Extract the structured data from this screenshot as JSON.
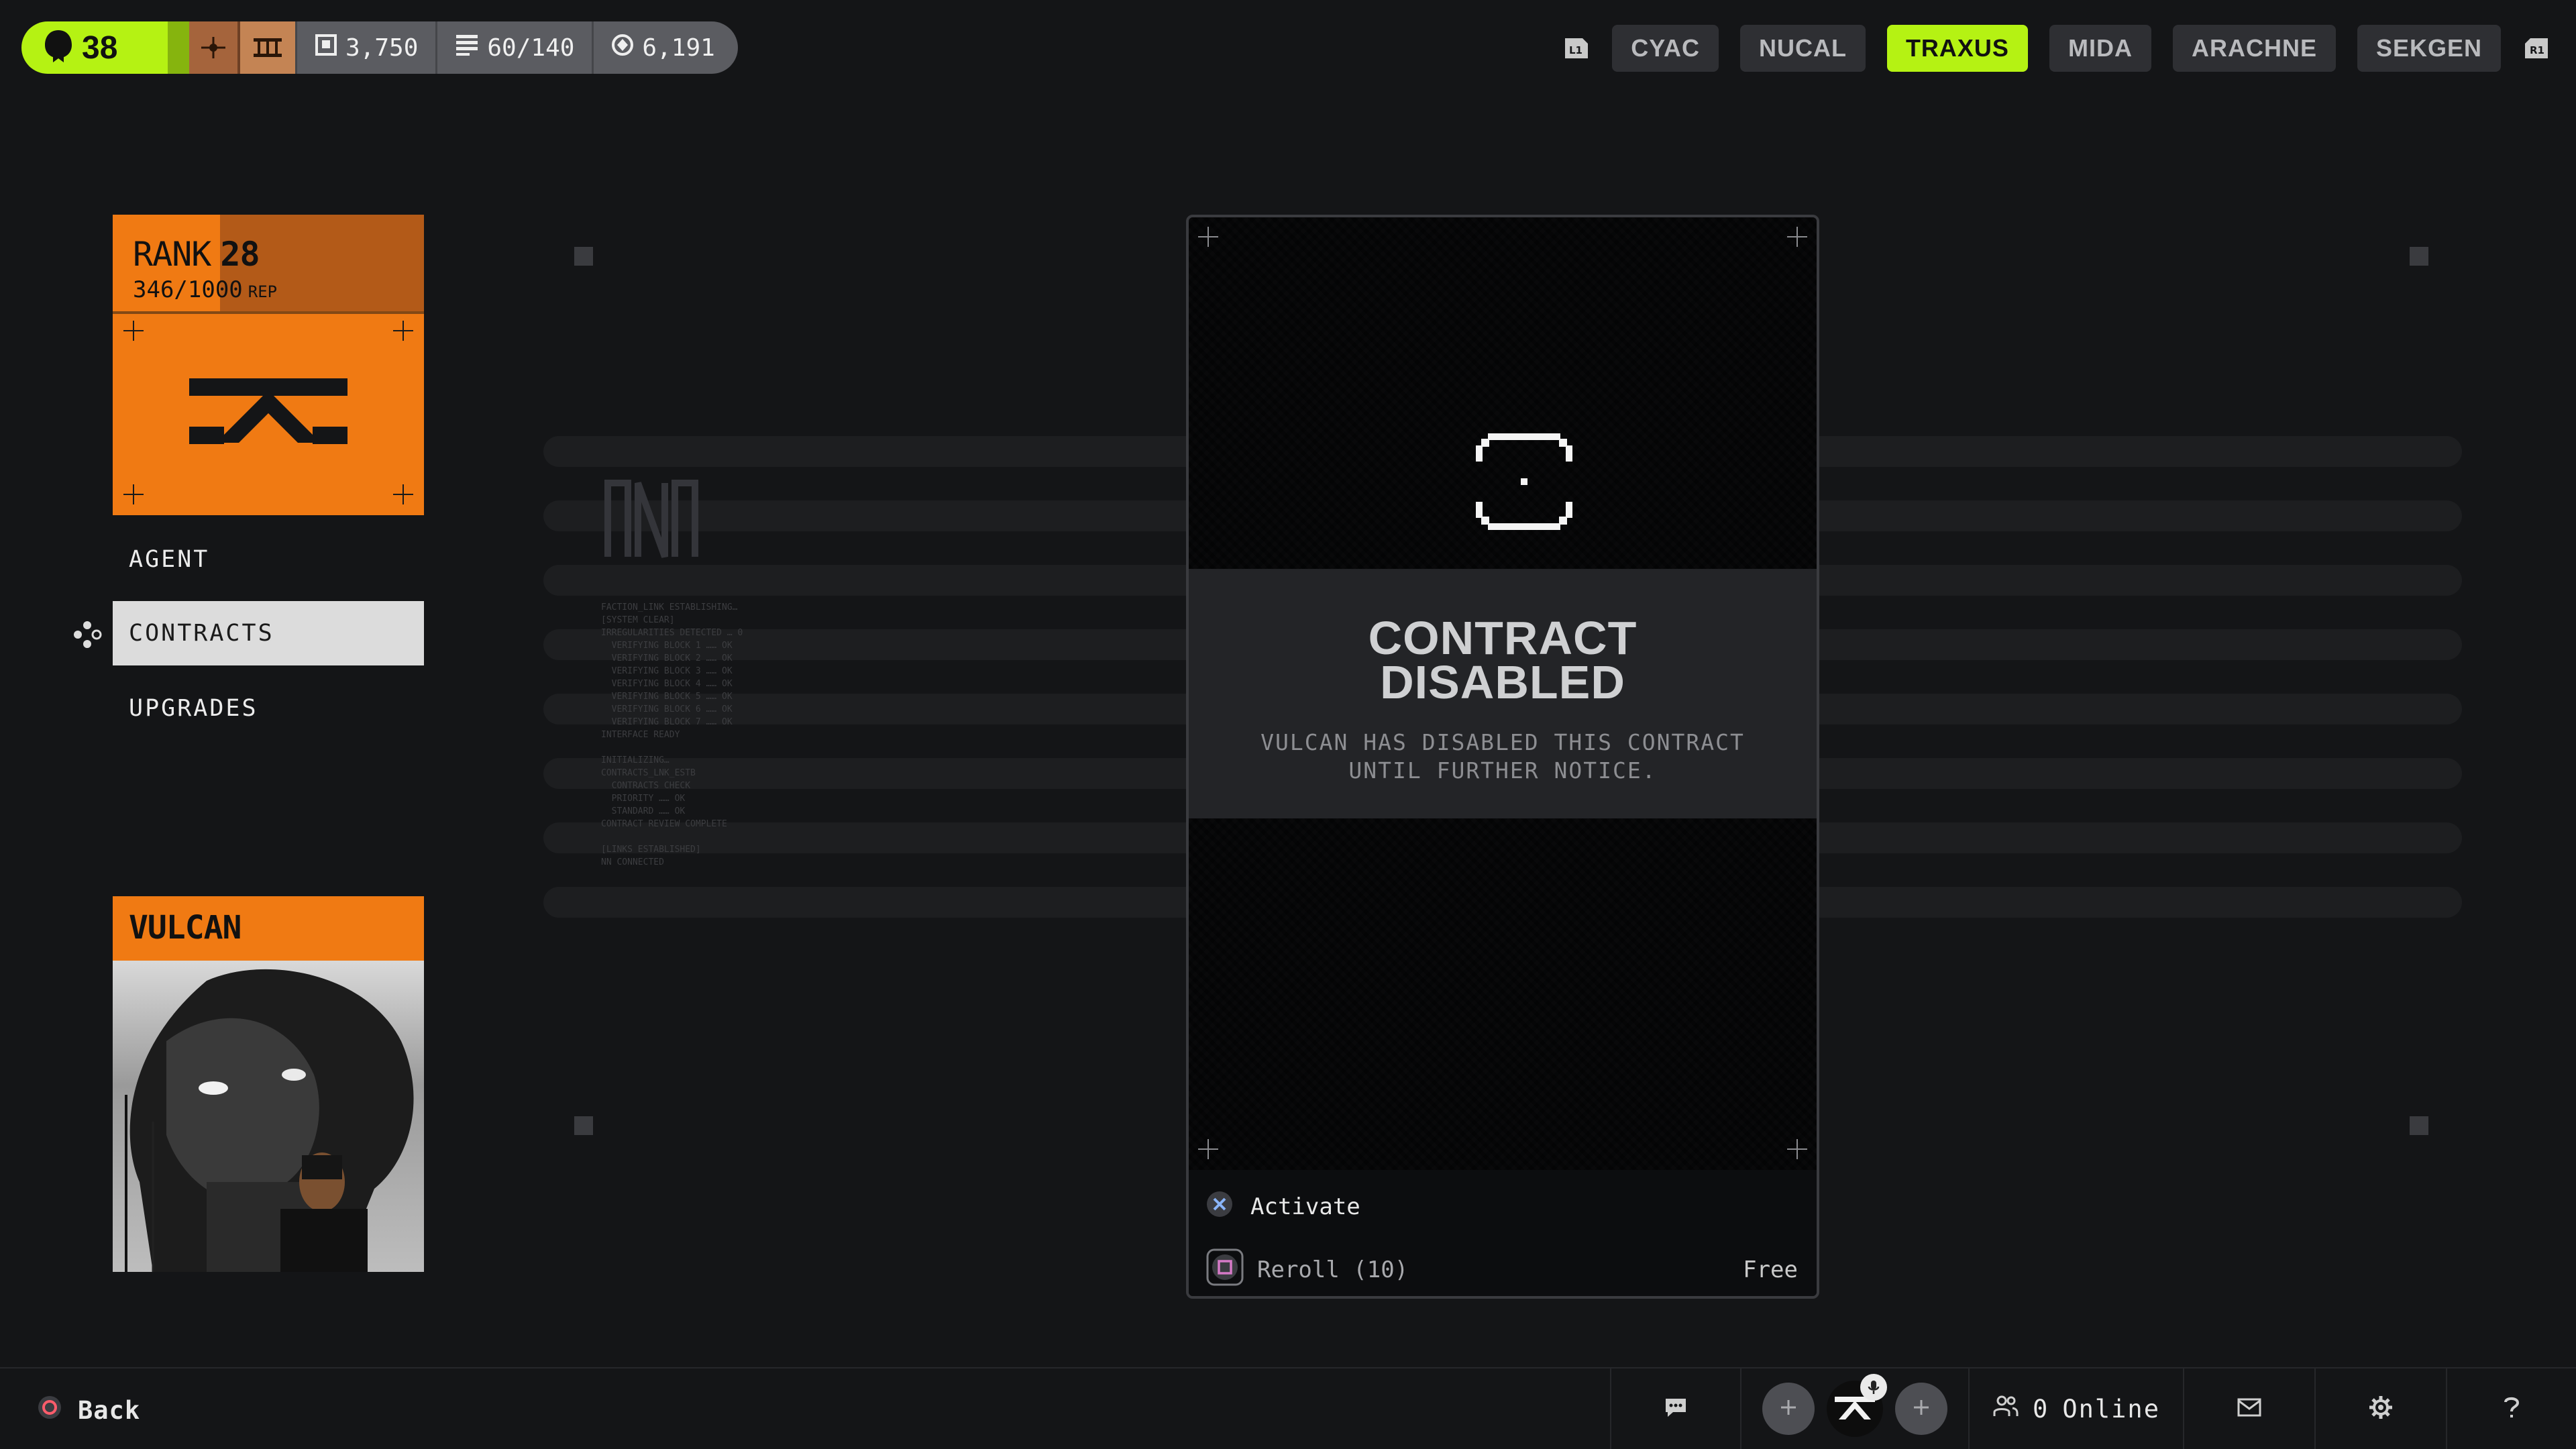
{
  "header": {
    "level": "38",
    "stats": [
      {
        "icon": "vault-icon",
        "value": "3,750"
      },
      {
        "icon": "inventory-icon",
        "value": "60/140"
      },
      {
        "icon": "credits-icon",
        "value": "6,191"
      }
    ],
    "left_shoulder": "L1",
    "right_shoulder": "R1",
    "factions": [
      "CYAC",
      "NUCAL",
      "TRAXUS",
      "MIDA",
      "ARACHNE",
      "SEKGEN"
    ],
    "active_faction": "TRAXUS"
  },
  "rank": {
    "label": "RANK",
    "value": "28",
    "rep": "346/1000",
    "rep_unit": "REP"
  },
  "menu": {
    "items": [
      "AGENT",
      "CONTRACTS",
      "UPGRADES"
    ],
    "selected": "CONTRACTS"
  },
  "agent": {
    "name": "VULCAN"
  },
  "boot_log": "FACTION_LINK ESTABLISHING…\n[SYSTEM CLEAR]\nIRREGULARITIES DETECTED … 0\n  VERIFYING BLOCK 1 …… OK\n  VERIFYING BLOCK 2 …… OK\n  VERIFYING BLOCK 3 …… OK\n  VERIFYING BLOCK 4 …… OK\n  VERIFYING BLOCK 5 …… OK\n  VERIFYING BLOCK 6 …… OK\n  VERIFYING BLOCK 7 …… OK\nINTERFACE READY\n\nINITIALIZING…\nCONTRACTS_LNK_ESTB\n  CONTRACTS CHECK\n  PRIORITY …… OK\n  STANDARD …… OK\nCONTRACT REVIEW COMPLETE\n\n[LINKS ESTABLISHED]\nNN CONNECTED",
  "contract": {
    "title_line1": "CONTRACT",
    "title_line2": "DISABLED",
    "subtitle_line1": "VULCAN HAS DISABLED THIS CONTRACT",
    "subtitle_line2": "UNTIL FURTHER NOTICE.",
    "activate_label": "Activate",
    "reroll_label": "Reroll (10)",
    "reroll_cost": "Free"
  },
  "footer": {
    "back_label": "Back",
    "online_count": "0",
    "online_label": "Online"
  },
  "colors": {
    "accent_lime": "#b5f213",
    "faction_orange": "#f07a13",
    "background": "#141517"
  }
}
